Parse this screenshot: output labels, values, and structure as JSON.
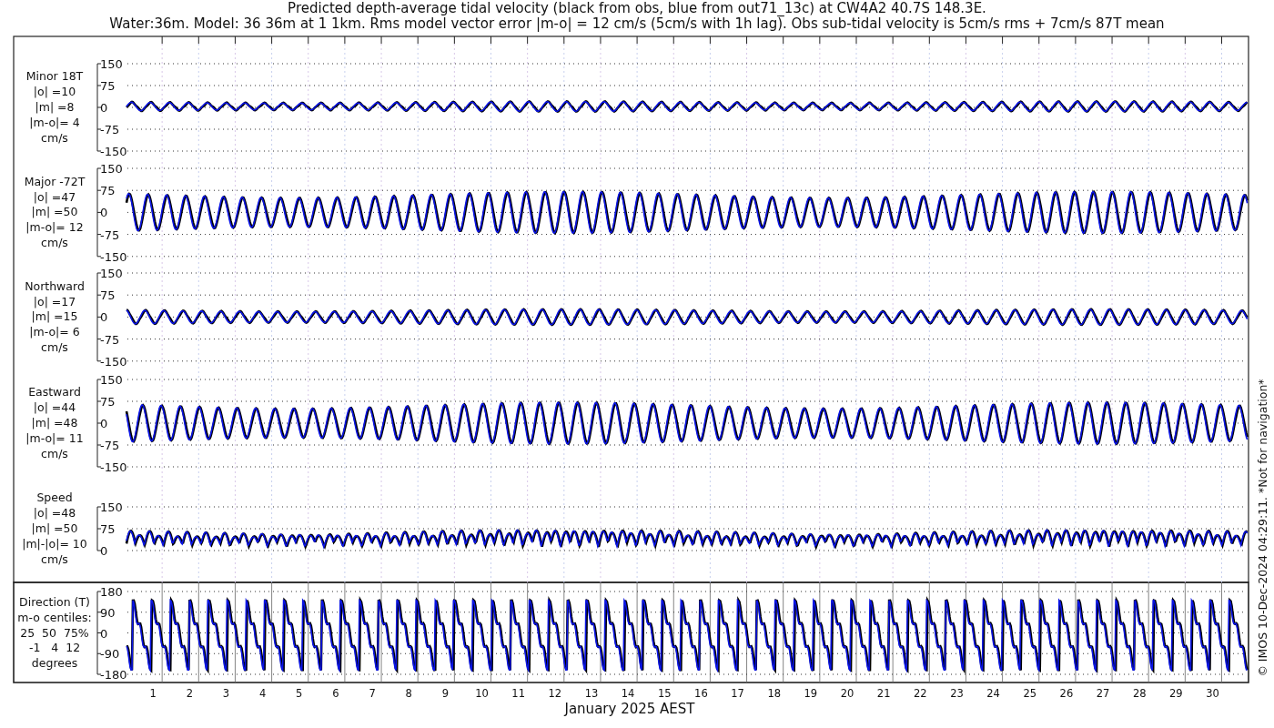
{
  "title_lines": [
    "Predicted depth-average tidal velocity (black from obs, blue from out71_13c) at CW4A2 40.7S 148.3E.",
    "Water:36m. Model: 36 36m at 1 1km. Rms model vector error |m-o| = 12 cm/s (5cm/s with 1h lag). Obs sub-tidal velocity is 5cm/s rms + 7cm/s 87T mean"
  ],
  "panels": [
    {
      "kind": "velocity",
      "label_lines": [
        "Minor 18T",
        "|o| =10",
        "|m| =8",
        "|m-o|= 4",
        "cm/s"
      ],
      "yticks": [
        "150",
        "75",
        "0",
        "-75",
        "-150"
      ]
    },
    {
      "kind": "velocity",
      "label_lines": [
        "Major -72T",
        "|o| =47",
        "|m| =50",
        "|m-o|= 12",
        "cm/s"
      ],
      "yticks": [
        "150",
        "75",
        "0",
        "-75",
        "-150"
      ]
    },
    {
      "kind": "velocity",
      "label_lines": [
        "Northward",
        "|o| =17",
        "|m| =15",
        "|m-o|= 6",
        "cm/s"
      ],
      "yticks": [
        "150",
        "75",
        "0",
        "-75",
        "-150"
      ]
    },
    {
      "kind": "velocity",
      "label_lines": [
        "Eastward",
        "|o| =44",
        "|m| =48",
        "|m-o|= 11",
        "cm/s"
      ],
      "yticks": [
        "150",
        "75",
        "0",
        "-75",
        "-150"
      ]
    },
    {
      "kind": "speed",
      "label_lines": [
        "Speed",
        "|o| =48",
        "|m| =50",
        "|m|-|o|= 10",
        "cm/s"
      ],
      "yticks": [
        "150",
        "75",
        "0"
      ]
    },
    {
      "kind": "direction",
      "label_lines": [
        "Direction (T)",
        "m-o centiles:",
        "25  50  75%",
        "-1   4  12",
        "degrees"
      ],
      "yticks": [
        "180",
        "90",
        "0",
        "-90",
        "-180"
      ]
    }
  ],
  "x_axis": {
    "days": [
      "1",
      "2",
      "3",
      "4",
      "5",
      "6",
      "7",
      "8",
      "9",
      "10",
      "11",
      "12",
      "13",
      "14",
      "15",
      "16",
      "17",
      "18",
      "19",
      "20",
      "21",
      "22",
      "23",
      "24",
      "25",
      "26",
      "27",
      "28",
      "29",
      "30"
    ],
    "label": "January 2025 AEST"
  },
  "side_note": "© IMOS 10-Dec-2024 04:29:11. *Not for navigation*"
}
